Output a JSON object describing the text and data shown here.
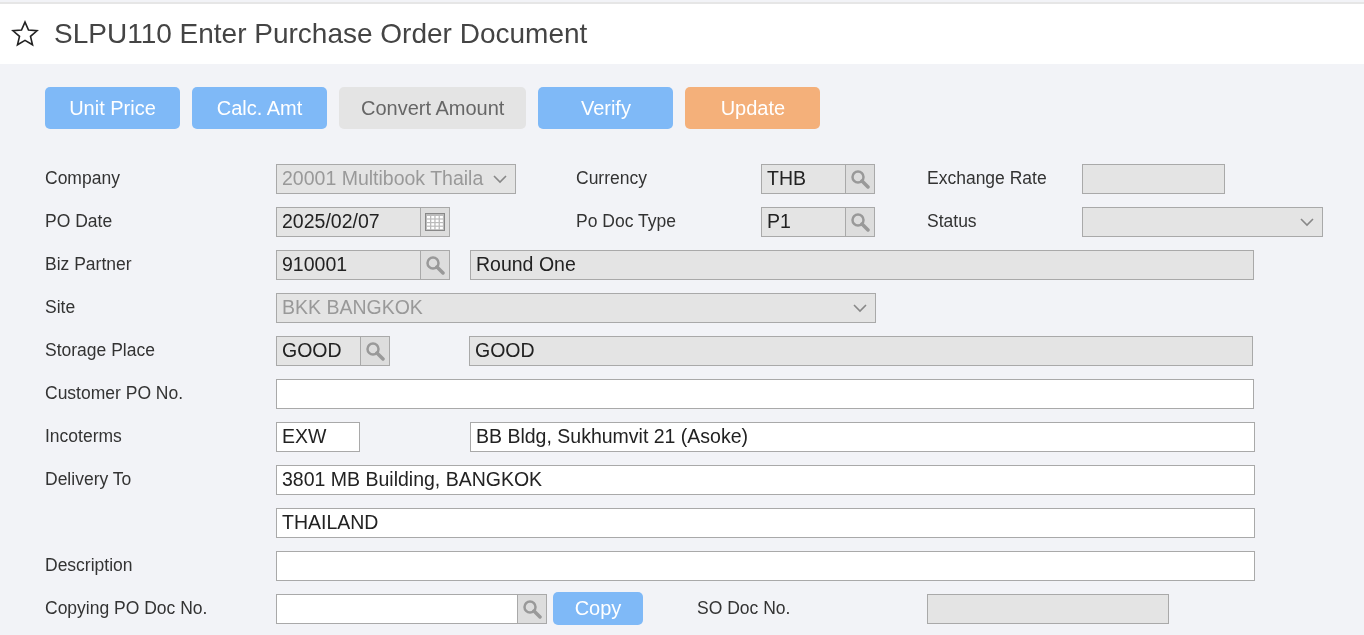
{
  "page": {
    "title": "SLPU110 Enter Purchase Order Document",
    "favorite": false
  },
  "toolbar": [
    {
      "label": "Unit Price",
      "kind": "primary",
      "disabled": false
    },
    {
      "label": "Calc. Amt",
      "kind": "primary",
      "disabled": false
    },
    {
      "label": "Convert Amount",
      "kind": "primary",
      "disabled": true
    },
    {
      "label": "Verify",
      "kind": "primary",
      "disabled": false
    },
    {
      "label": "Update",
      "kind": "warning",
      "disabled": false
    }
  ],
  "form": [
    {
      "label": "Company",
      "items": [
        {
          "kind": "select",
          "value": "20001 Multibook Thaila",
          "disabled": true
        },
        {
          "kind": "label",
          "text": "Currency"
        },
        {
          "kind": "lookup",
          "value": "THB",
          "readonly": true
        },
        {
          "kind": "label",
          "text": "Exchange Rate"
        },
        {
          "kind": "text",
          "readonly": true
        }
      ]
    },
    {
      "label": "PO Date",
      "items": [
        {
          "kind": "date",
          "value": "2025/02/07",
          "readonly": true
        },
        {
          "kind": "label",
          "text": "Po Doc Type"
        },
        {
          "kind": "lookup",
          "value": "P1",
          "readonly": true
        },
        {
          "kind": "label",
          "text": "Status"
        },
        {
          "kind": "select",
          "disabled": true
        }
      ]
    },
    {
      "label": "Biz Partner",
      "items": [
        {
          "kind": "lookup",
          "value": "910001",
          "readonly": true
        },
        {
          "kind": "text",
          "value": "Round One",
          "readonly": true
        }
      ]
    },
    {
      "label": "Site",
      "items": [
        {
          "kind": "select",
          "value": "BKK BANGKOK",
          "disabled": true
        }
      ]
    },
    {
      "label": "Storage Place",
      "items": [
        {
          "kind": "lookup",
          "value": "GOOD",
          "readonly": true
        },
        {
          "kind": "text",
          "value": "GOOD",
          "readonly": true
        }
      ]
    },
    {
      "label": "Customer PO No.",
      "items": [
        {
          "kind": "text",
          "readonly": false
        }
      ]
    },
    {
      "label": "Incoterms",
      "items": [
        {
          "kind": "text",
          "value": "EXW",
          "readonly": false
        },
        {
          "kind": "text",
          "value": "BB Bldg, Sukhumvit 21 (Asoke)",
          "readonly": false
        }
      ]
    },
    {
      "label": "Delivery To",
      "items": [
        {
          "kind": "text",
          "value": "3801 MB Building, BANGKOK",
          "readonly": false
        }
      ]
    },
    {
      "items": [
        {
          "kind": "text",
          "value": "THAILAND",
          "readonly": false
        }
      ]
    },
    {
      "label": "Description",
      "items": [
        {
          "kind": "text",
          "readonly": false
        }
      ]
    },
    {
      "label": "Copying PO Doc No.",
      "items": [
        {
          "kind": "lookup",
          "readonly": false
        },
        {
          "kind": "button",
          "text": "Copy"
        },
        {
          "kind": "label",
          "text": "SO Doc No."
        },
        {
          "kind": "text",
          "readonly": true
        }
      ]
    }
  ]
}
